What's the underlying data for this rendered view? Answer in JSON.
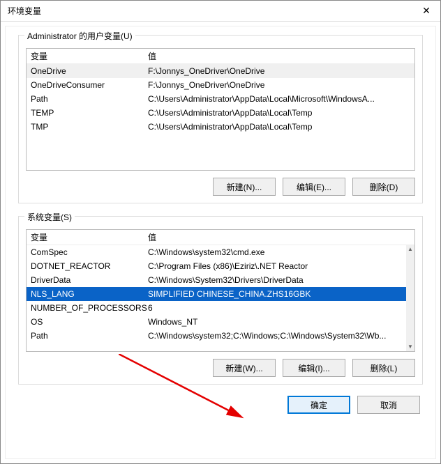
{
  "window": {
    "title": "环境变量"
  },
  "user_vars": {
    "group_label": "Administrator 的用户变量(U)",
    "header": {
      "name": "变量",
      "value": "值"
    },
    "rows": [
      {
        "name": "OneDrive",
        "value": "F:\\Jonnys_OneDriver\\OneDrive"
      },
      {
        "name": "OneDriveConsumer",
        "value": "F:\\Jonnys_OneDriver\\OneDrive"
      },
      {
        "name": "Path",
        "value": "C:\\Users\\Administrator\\AppData\\Local\\Microsoft\\WindowsA..."
      },
      {
        "name": "TEMP",
        "value": "C:\\Users\\Administrator\\AppData\\Local\\Temp"
      },
      {
        "name": "TMP",
        "value": "C:\\Users\\Administrator\\AppData\\Local\\Temp"
      }
    ],
    "buttons": {
      "new": "新建(N)...",
      "edit": "编辑(E)...",
      "delete": "删除(D)"
    }
  },
  "sys_vars": {
    "group_label": "系统变量(S)",
    "header": {
      "name": "变量",
      "value": "值"
    },
    "rows": [
      {
        "name": "ComSpec",
        "value": "C:\\Windows\\system32\\cmd.exe"
      },
      {
        "name": "DOTNET_REACTOR",
        "value": "C:\\Program Files (x86)\\Eziriz\\.NET Reactor"
      },
      {
        "name": "DriverData",
        "value": "C:\\Windows\\System32\\Drivers\\DriverData"
      },
      {
        "name": "NLS_LANG",
        "value": "SIMPLIFIED CHINESE_CHINA.ZHS16GBK"
      },
      {
        "name": "NUMBER_OF_PROCESSORS",
        "value": "6"
      },
      {
        "name": "OS",
        "value": "Windows_NT"
      },
      {
        "name": "Path",
        "value": "C:\\Windows\\system32;C:\\Windows;C:\\Windows\\System32\\Wb..."
      }
    ],
    "buttons": {
      "new": "新建(W)...",
      "edit": "编辑(I)...",
      "delete": "删除(L)"
    }
  },
  "footer": {
    "ok": "确定",
    "cancel": "取消"
  }
}
